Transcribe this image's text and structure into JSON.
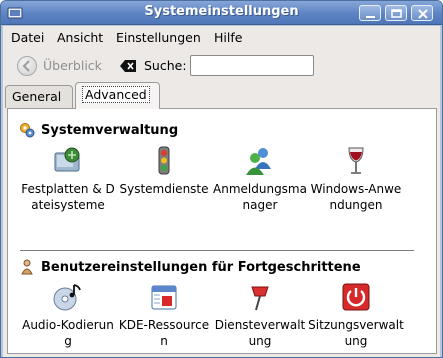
{
  "window": {
    "title": "Systemeinstellungen"
  },
  "menu": {
    "items": [
      {
        "label": "Datei"
      },
      {
        "label": "Ansicht"
      },
      {
        "label": "Einstellungen"
      },
      {
        "label": "Hilfe"
      }
    ]
  },
  "toolbar": {
    "back_label": "Überblick",
    "search_label": "Suche:",
    "search_value": "",
    "search_placeholder": ""
  },
  "tabs": [
    {
      "label": "General",
      "active": false
    },
    {
      "label": "Advanced",
      "active": true
    }
  ],
  "sections": [
    {
      "title": "Systemverwaltung",
      "icon": "system-admin-icon",
      "modules": [
        {
          "label": "Festplatten & Dateisysteme",
          "icon": "harddisk-icon"
        },
        {
          "label": "Systemdienste",
          "icon": "traffic-light-icon"
        },
        {
          "label": "Anmeldungsmanager",
          "icon": "users-icon"
        },
        {
          "label": "Windows-Anwendungen",
          "icon": "wine-glass-icon"
        }
      ]
    },
    {
      "title": "Benutzereinstellungen für Fortgeschrittene",
      "icon": "user-advanced-icon",
      "modules": [
        {
          "label": "Audio-Kodierung",
          "icon": "audio-cd-icon"
        },
        {
          "label": "KDE-Ressourcen",
          "icon": "calendar-icon"
        },
        {
          "label": "Diensteverwaltung",
          "icon": "service-pin-icon"
        },
        {
          "label": "Sitzungsverwaltung",
          "icon": "power-icon"
        }
      ]
    }
  ],
  "colors": {
    "titlebar": "#5d83c3",
    "window_bg": "#ece9e6",
    "panel_bg": "#ffffff"
  }
}
